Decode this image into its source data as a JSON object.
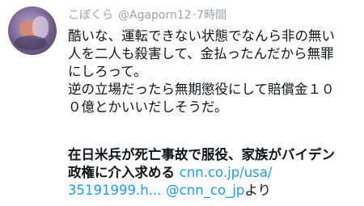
{
  "tweet": {
    "display_name": "こぼくら",
    "handle": "@Agaporn12",
    "separator": "·",
    "time": "7時間",
    "body_lines": [
      "酷いな、運転できない状態でなんら非の無い",
      "人を二人も殺害して、金払ったんだから無罪",
      "にしろって。",
      "逆の立場だったら無期懲役にして賠償金１０",
      "０億とかいいだしそうだ。"
    ],
    "news": {
      "headline_line1": "在日米兵が死亡事故で服役、家族がバイデン",
      "headline_line2": "政権に介入求める",
      "link1": "cnn.co.jp/usa/",
      "link2": "35191999.h...",
      "mention": "@cnn_co_jp",
      "suffix": "より"
    }
  },
  "colors": {
    "link": "#1d9bf0",
    "text": "#0f1419",
    "meta": "#9aa3ab"
  }
}
